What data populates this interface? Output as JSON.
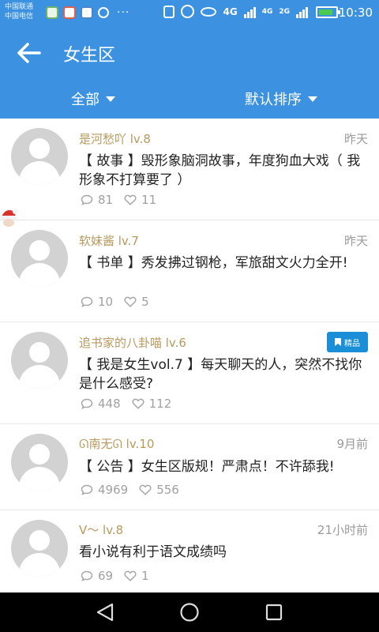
{
  "status_bar": {
    "carrier_1": "中国联通",
    "carrier_2": "中国电信",
    "more": "···",
    "net_type_1": "4G",
    "net_type_2": "4G",
    "net_type_3": "2G",
    "time": "10:30",
    "battery_level": 0.75
  },
  "app_bar": {
    "title": "女生区",
    "filter_left": "全部",
    "filter_right": "默认排序"
  },
  "posts": [
    {
      "username": "是河愁吖 lv.8",
      "time": "昨天",
      "title": "【 故事 】毁形象脑洞故事，年度狗血大戏（ 我形象不打算要了 ）",
      "comments": "81",
      "likes": "11"
    },
    {
      "username": "软妹酱 lv.7",
      "time": "昨天",
      "title": "【 书单 】秀发拂过钢枪，军旅甜文火力全开!",
      "comments": "10",
      "likes": "5"
    },
    {
      "username": "追书家的八卦喵 lv.6",
      "badge": "精品",
      "title": "【 我是女生vol.7 】每天聊天的人，突然不找你是什么感受?",
      "comments": "448",
      "likes": "112"
    },
    {
      "username": "ᘏ南无ᘏ lv.10",
      "time": "9月前",
      "title": "【 公告 】女生区版规！严肃点！不许舔我!",
      "comments": "4969",
      "likes": "556"
    },
    {
      "username": "V～ lv.8",
      "time": "21小时前",
      "title": "看小说有利于语文成绩吗",
      "comments": "69",
      "likes": "1"
    }
  ],
  "colors": {
    "primary": "#3c92e0",
    "username": "#b6995d",
    "badge": "#1a8fd8"
  }
}
